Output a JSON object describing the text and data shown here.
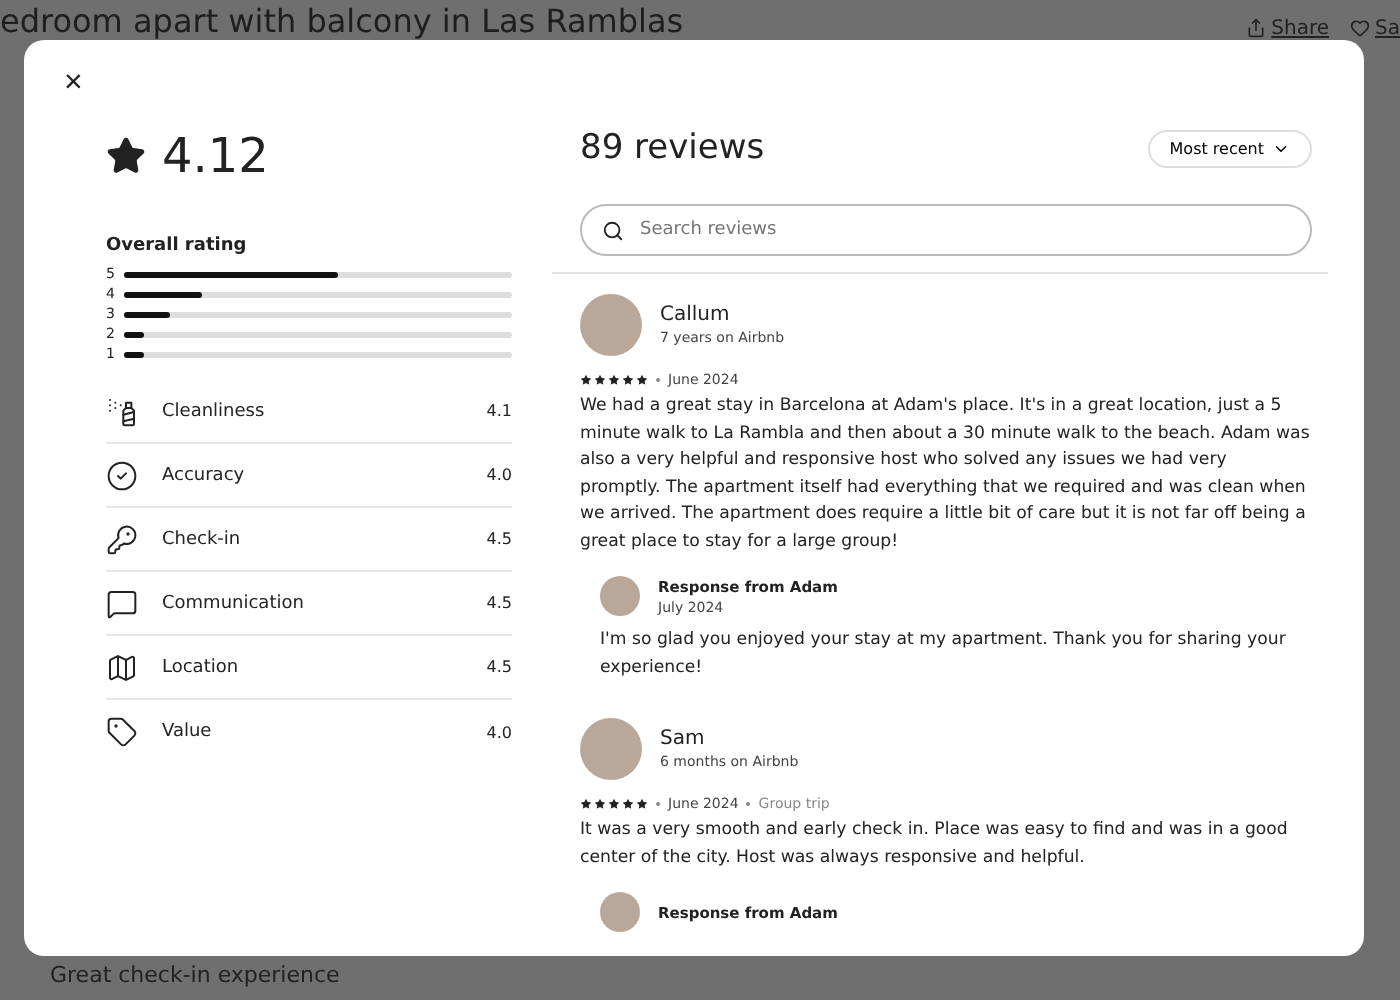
{
  "page": {
    "title": "edroom apart with balcony in Las Ramblas",
    "actions": [
      "Share",
      "Sa"
    ],
    "footer": "Great check-in experience"
  },
  "modal": {
    "close": "×",
    "rating": "4.12",
    "overall": {
      "label": "Overall rating",
      "bars": [
        {
          "label": "5",
          "level": 0.55
        },
        {
          "label": "4",
          "level": 0.2
        },
        {
          "label": "3",
          "level": 0.12
        },
        {
          "label": "2",
          "level": 0.05
        },
        {
          "label": "1",
          "level": 0.05
        }
      ]
    },
    "categories": [
      {
        "kind": "cleanliness",
        "label": "Cleanliness",
        "value": "4.1"
      },
      {
        "kind": "accuracy",
        "label": "Accuracy",
        "value": "4.0"
      },
      {
        "kind": "checkin",
        "label": "Check-in",
        "value": "4.5"
      },
      {
        "kind": "communication",
        "label": "Communication",
        "value": "4.5"
      },
      {
        "kind": "location",
        "label": "Location",
        "value": "4.5"
      },
      {
        "kind": "value",
        "label": "Value",
        "value": "4.0"
      }
    ],
    "reviews_title": "89 reviews",
    "sort": "Most recent",
    "search": {
      "placeholder": "Search reviews"
    },
    "reviews": [
      {
        "name": "Callum",
        "tenure": "7 years on Airbnb",
        "stars": 5,
        "date": "June 2024",
        "text": "We had a great stay in Barcelona at Adam's place. It's in a great location, just a 5 minute walk to La Rambla and then about a 30 minute walk to the beach. Adam was also a very helpful and responsive host who solved any issues we had very promptly. The apartment itself had everything that we required and was clean when we arrived. The apartment does require a little bit of care but it is not far off being a great place to stay for a large group!",
        "response": {
          "title": "Response from Adam",
          "date": "July 2024",
          "text": "I'm so glad you enjoyed your stay at my apartment. Thank you for sharing your experience!"
        }
      },
      {
        "name": "Sam",
        "tenure": "6 months on Airbnb",
        "stars": 5,
        "date": "June 2024",
        "trip": "Group trip",
        "text": "It was a very smooth and early check in. Place was easy to find and was in a good center of the city. Host was always responsive and helpful.",
        "response": {
          "title": "Response from Adam"
        }
      }
    ]
  }
}
